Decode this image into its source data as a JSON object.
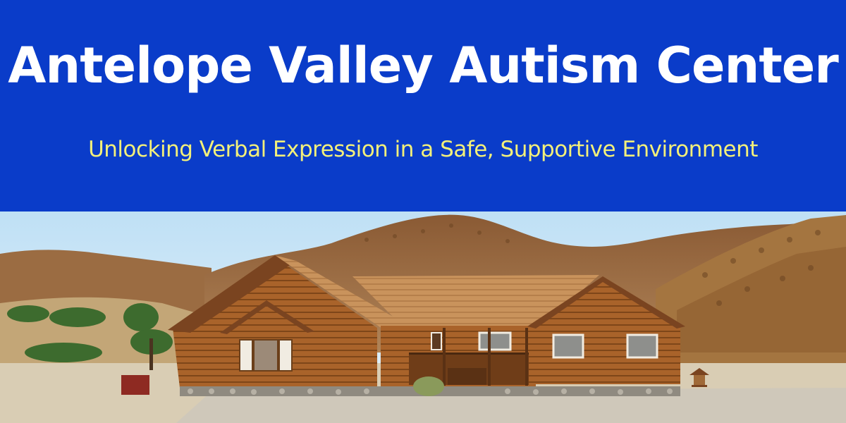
{
  "banner": {
    "title": "Antelope Valley Autism Center",
    "subtitle": "Unlocking Verbal Expression in a Safe, Supportive Environment"
  },
  "colors": {
    "banner_bg": "#0a3cc9",
    "title": "#ffffff",
    "subtitle": "#f3f07a"
  },
  "photo": {
    "subject": "log-cabin-house-photo"
  }
}
